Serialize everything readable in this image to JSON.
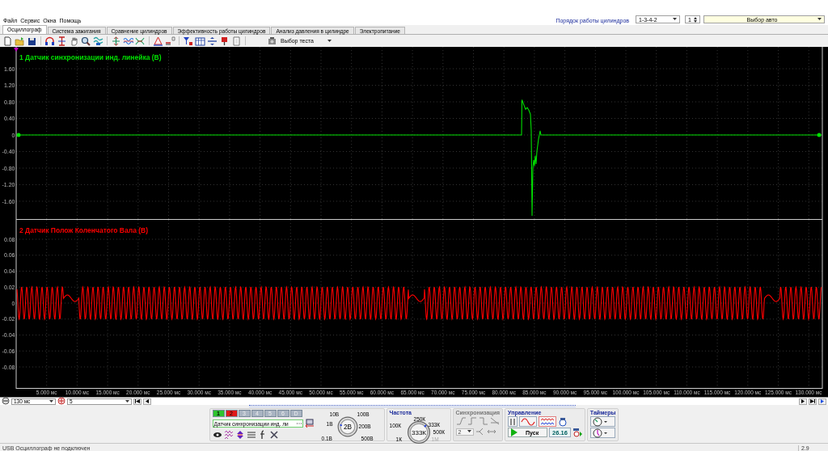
{
  "menu": [
    "Файл",
    "Сервис",
    "Окна",
    "Помощь"
  ],
  "cylinder_order": {
    "label": "Порядок работы цилиндров",
    "value": "1-3-4-2",
    "spin": "1",
    "auto": "Выбор авто"
  },
  "tabs": [
    {
      "label": "Осциллограф",
      "selected": true
    },
    {
      "label": "Система зажигания",
      "selected": false
    },
    {
      "label": "Сравнение цилиндров",
      "selected": false
    },
    {
      "label": "Эффективность работы цилиндров",
      "selected": false
    },
    {
      "label": "Анализ давления в цилиндре",
      "selected": false
    },
    {
      "label": "Электропитание",
      "selected": false
    }
  ],
  "toolbar": {
    "test_select": "Выбор теста"
  },
  "plots": [
    {
      "kind": "spike",
      "title": "1 Датчик синхронизации инд. линейка (В)",
      "color": "#00e000",
      "y_labels": [
        "1.60",
        "1.20",
        "0.80",
        "0.40",
        "0",
        "-0.40",
        "-0.80",
        "-1.20",
        "-1.60"
      ]
    },
    {
      "kind": "sine",
      "title": "2 Датчик Полож Коленчатого Вала (В)",
      "color": "#ff0000",
      "y_labels": [
        "0.08",
        "0.06",
        "0.04",
        "0.02",
        "0",
        "-0.02",
        "-0.04",
        "-0.06",
        "-0.08"
      ]
    }
  ],
  "x_labels": [
    "5.000 мс",
    "10.000 мс",
    "15.000 мс",
    "20.000 мс",
    "25.000 мс",
    "30.000 мс",
    "35.000 мс",
    "40.000 мс",
    "45.000 мс",
    "50.000 мс",
    "55.000 мс",
    "60.000 мс",
    "65.000 мс",
    "70.000 мс",
    "75.000 мс",
    "80.000 мс",
    "85.000 мс",
    "90.000 мс",
    "95.000 мс",
    "100.000 мс",
    "105.000 мс",
    "110.000 мс",
    "115.000 мс",
    "120.000 мс",
    "125.000 мс",
    "130.000 мс"
  ],
  "timebase": {
    "value": "130 мс",
    "divisions": "5"
  },
  "channels": [
    {
      "label": "1",
      "selected": true,
      "disabled": false,
      "color": "#2ec42e"
    },
    {
      "label": "2",
      "selected": false,
      "disabled": false,
      "color": "#e01818"
    },
    {
      "label": "3",
      "selected": false,
      "disabled": true,
      "color": "#a9b4c2"
    },
    {
      "label": "4",
      "selected": false,
      "disabled": true,
      "color": "#a9b4c2"
    },
    {
      "label": "5",
      "selected": false,
      "disabled": true,
      "color": "#a9b4c2"
    },
    {
      "label": "6",
      "selected": false,
      "disabled": true,
      "color": "#a9b4c2"
    },
    {
      "label": "D",
      "selected": false,
      "disabled": true,
      "color": "#a9b4c2"
    }
  ],
  "sensor_select": "Датчик синхронизации инд. ли",
  "voltage_knob": {
    "value": "2В",
    "labels": [
      "10В",
      "100В",
      "1В",
      "200В",
      "0.1В",
      "500В"
    ]
  },
  "frequency": {
    "title": "Частота",
    "value": "333К",
    "labels": [
      "250К",
      "100К",
      "333К",
      "500К",
      "1К",
      "1М"
    ]
  },
  "sync": {
    "title": "Синхронизация",
    "disabled": true,
    "value": "2"
  },
  "control": {
    "title": "Управление",
    "start": "Пуск",
    "reading": "26.16"
  },
  "timers": {
    "title": "Таймеры"
  },
  "status": {
    "message": "USB Осциллограф не подключен",
    "version": "2.9"
  }
}
